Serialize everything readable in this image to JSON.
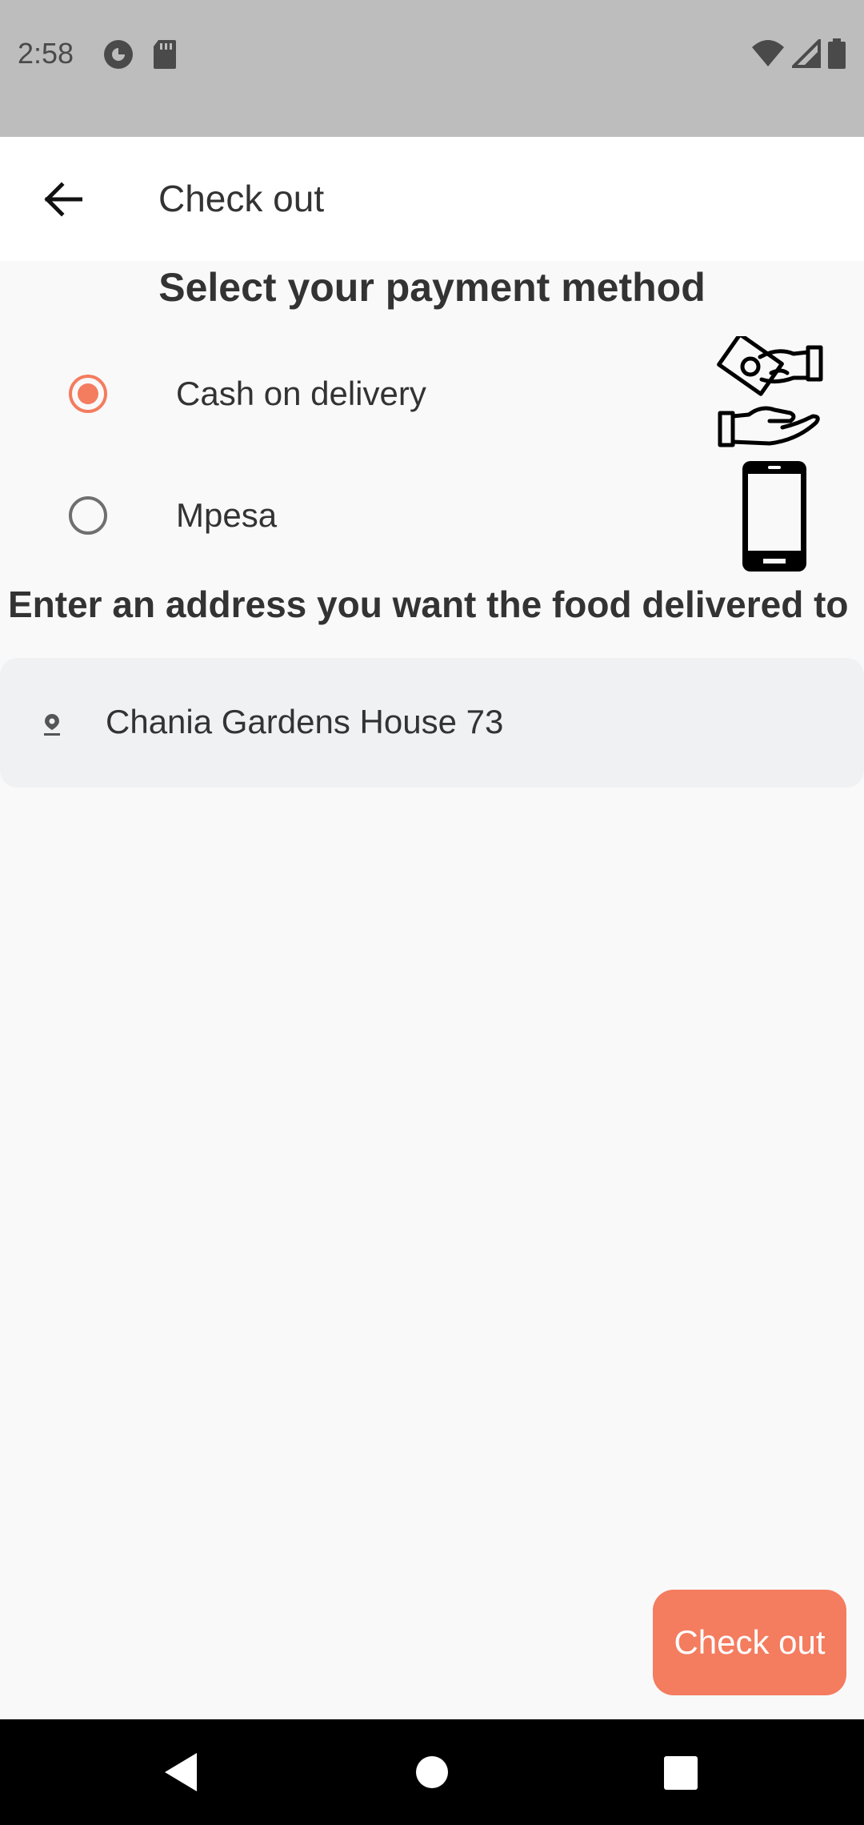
{
  "status_bar": {
    "time": "2:58",
    "icons": [
      "pocket-casts-icon",
      "sd-card-icon",
      "wifi-icon",
      "signal-icon",
      "battery-icon"
    ]
  },
  "app_bar": {
    "title": "Check out",
    "back_icon": "arrow-left-icon"
  },
  "payment": {
    "title": "Select your payment method",
    "options": [
      {
        "label": "Cash on delivery",
        "selected": true,
        "icon": "cash-hands-icon"
      },
      {
        "label": "Mpesa",
        "selected": false,
        "icon": "smartphone-icon"
      }
    ]
  },
  "address": {
    "title": "Enter an address you want the food delivered to",
    "value": "Chania Gardens House 73",
    "icon": "location-pin-icon"
  },
  "actions": {
    "checkout_label": "Check out"
  },
  "colors": {
    "accent": "#f47c5f",
    "status_bar": "#bdbdbd",
    "field_bg": "#f0f1f3"
  },
  "nav_bar": {
    "buttons": [
      "back-triangle-icon",
      "home-circle-icon",
      "recents-square-icon"
    ]
  }
}
